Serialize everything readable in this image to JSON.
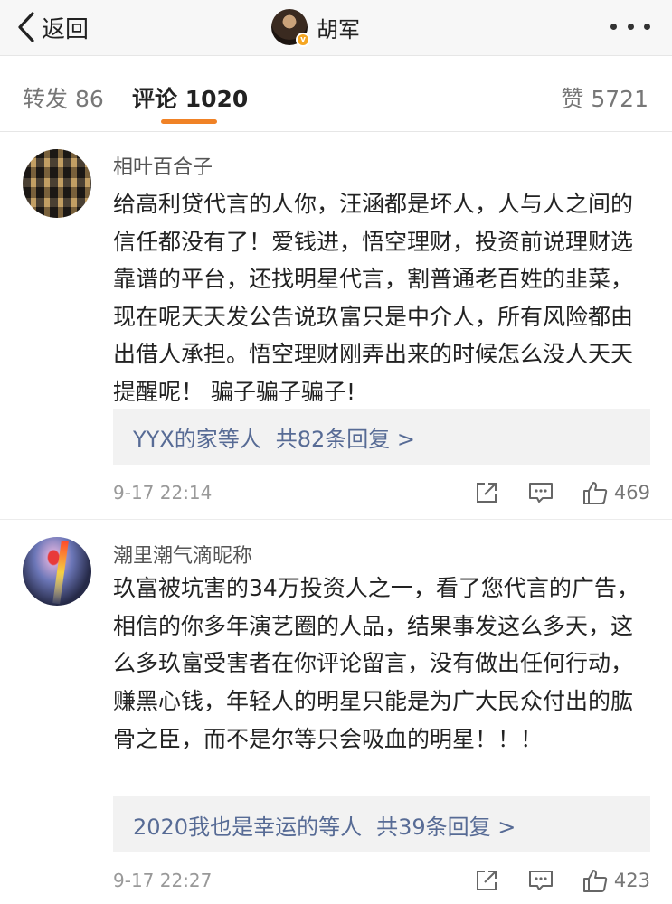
{
  "nav": {
    "back_label": "返回",
    "title": "胡军",
    "verified_badge": "v"
  },
  "tabs": {
    "repost": "转发 86",
    "comments": "评论 1020",
    "likes": "赞 5721"
  },
  "comments": [
    {
      "username": "相叶百合子",
      "text": "给高利贷代言的人你，汪涵都是坏人，人与人之间的信任都没有了！爱钱进，悟空理财，投资前说理财选靠谱的平台，还找明星代言，割普通老百姓的韭菜，现在呢天天发公告说玖富只是中介人，所有风险都由出借人承担。悟空理财刚弄出来的时候怎么没人天天提醒呢！ 骗子骗子骗子!",
      "replies_users": "YYX的家等人",
      "replies_count": "共82条回复 >",
      "time": "9-17 22:14",
      "likes": "469"
    },
    {
      "username": "潮里潮气滴昵称",
      "text": "玖富被坑害的34万投资人之一，看了您代言的广告，相信的你多年演艺圈的人品，结果事发这么多天，这么多玖富受害者在你评论留言，没有做出任何行动，赚黑心钱，年轻人的明星只能是为广大民众付出的肱骨之臣，而不是尔等只会吸血的明星！！！",
      "replies_users": "2020我也是幸运的等人",
      "replies_count": "共39条回复 >",
      "time": "9-17 22:27",
      "likes": "423"
    }
  ]
}
